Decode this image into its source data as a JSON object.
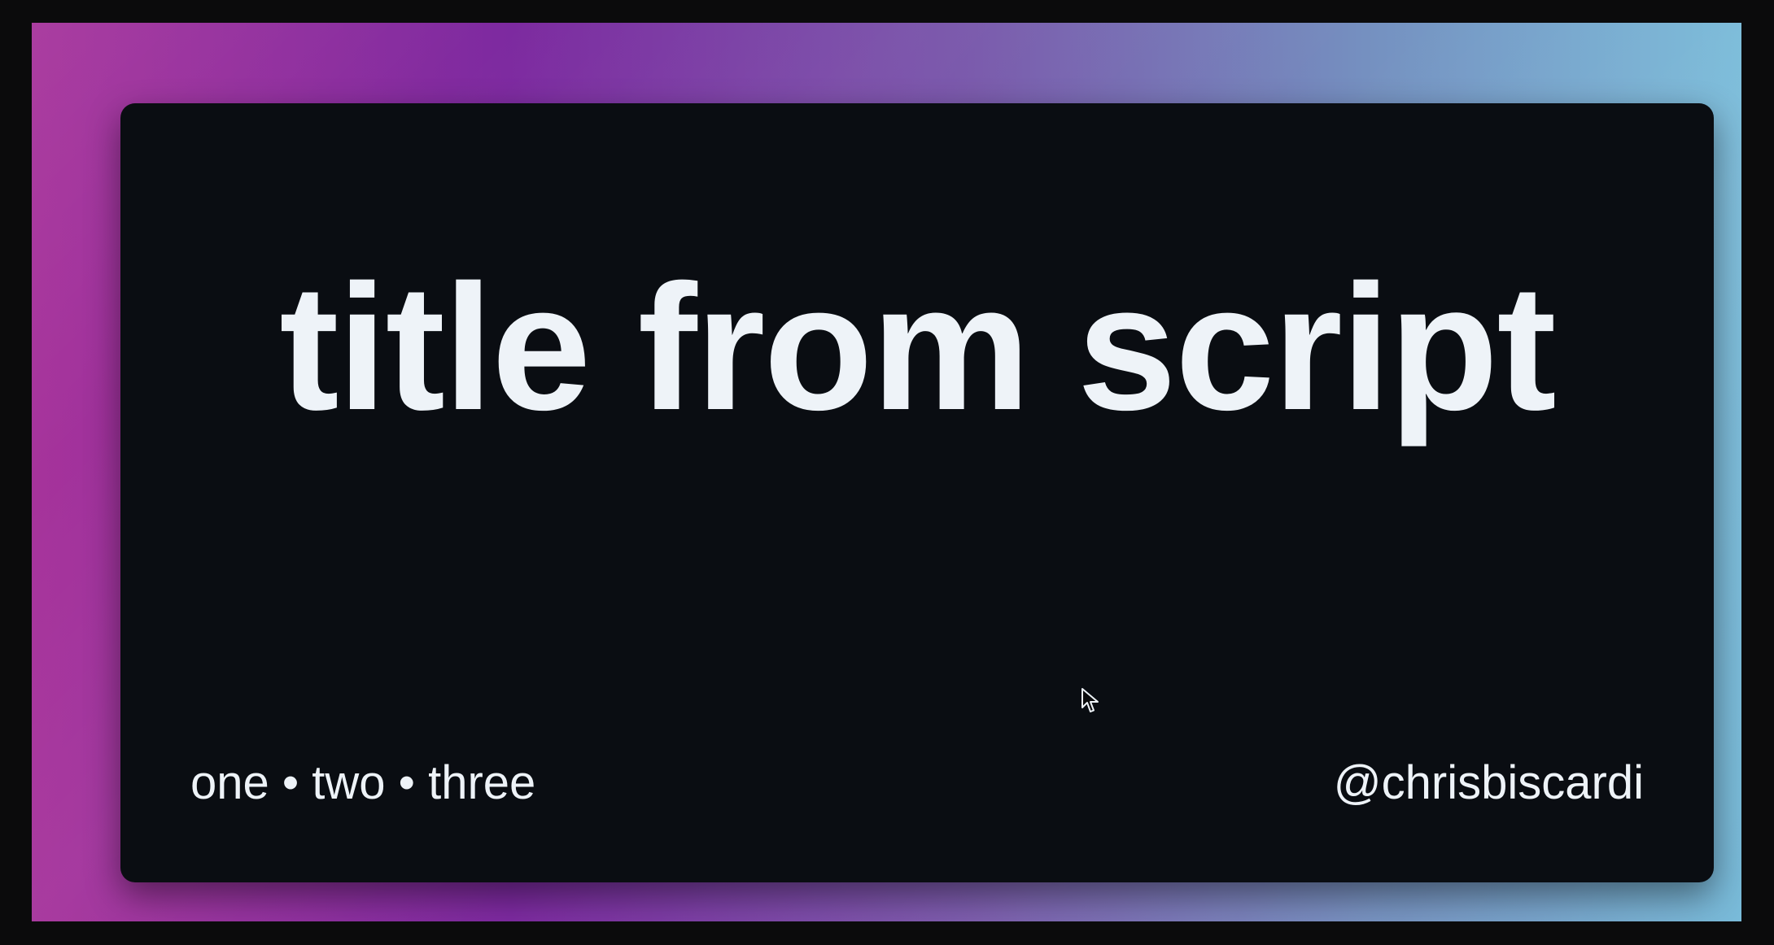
{
  "slide": {
    "title": "title from script",
    "footer_left": "one • two • three",
    "footer_right": "@chrisbiscardi"
  },
  "colors": {
    "page_background": "#0b0b0c",
    "card_background": "#0a0d12",
    "text": "#eef3f8",
    "gradient_left": "#a6339b",
    "gradient_mid": "#7756aa",
    "gradient_right": "#79bbd9"
  },
  "icons": {
    "cursor": "cursor-icon"
  }
}
